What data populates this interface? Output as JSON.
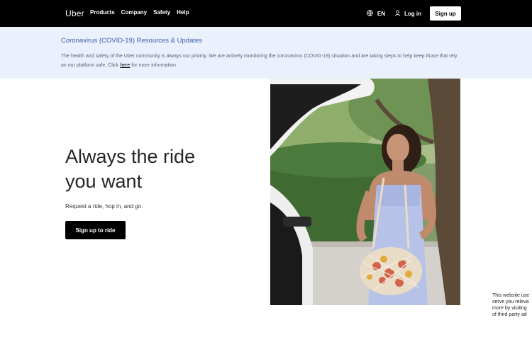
{
  "nav": {
    "logo": "Uber",
    "links": [
      "Products",
      "Company",
      "Safety",
      "Help"
    ],
    "language": "EN",
    "login": "Log in",
    "signup": "Sign up"
  },
  "banner": {
    "title": "Coronavirus (COVID-19) Resources & Updates",
    "text_before": "The health and safety of the Uber community is always our priority. We are actively monitoring the coronavirus (COVID-19) situation and are taking steps to help keep those that rely on our platform safe. Click ",
    "link": "here",
    "text_after": " for more information."
  },
  "hero": {
    "title_line1": "Always the ride",
    "title_line2": "you want",
    "subtitle": "Request a ride, hop in, and go.",
    "cta": "Sign up to ride"
  },
  "cookie": {
    "lines": [
      "This website use",
      "serve you releva",
      "more by visiting",
      "of third party ad"
    ]
  },
  "colors": {
    "nav_bg": "#000000",
    "banner_bg": "#eaf1fd",
    "banner_title": "#3a5ba7",
    "cta_bg": "#000000"
  }
}
